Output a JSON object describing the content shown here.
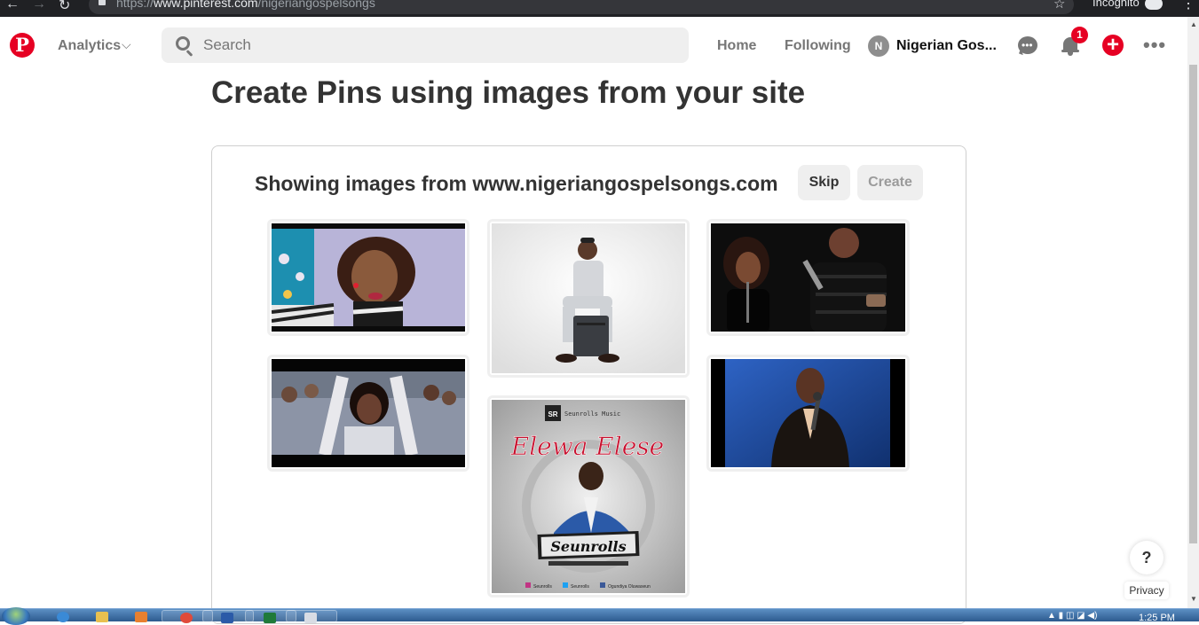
{
  "browser": {
    "url_scheme": "https://",
    "url_host": "www.pinterest.com",
    "url_path": "/nigeriangospelsongs",
    "incognito_label": "Incognito"
  },
  "header": {
    "analytics_label": "Analytics",
    "search_placeholder": "Search",
    "home_label": "Home",
    "following_label": "Following",
    "avatar_initial": "N",
    "profile_name": "Nigerian Gos...",
    "notification_count": "1",
    "icons": [
      "pinterest-logo-icon",
      "chevron-down-icon",
      "search-icon",
      "messages-icon",
      "bell-icon",
      "plus-icon",
      "more-icon"
    ],
    "colors": {
      "brand": "#e60023",
      "muted": "#767676"
    }
  },
  "main": {
    "title": "Create Pins using images from your site",
    "showing_text": "Showing images from www.nigeriangospelsongs.com",
    "skip_label": "Skip",
    "create_label": "Create",
    "images": [
      {
        "alt": "Woman singing in colorful headwrap"
      },
      {
        "alt": "Man in grey outfit seated on case"
      },
      {
        "alt": "Two singers performing on stage"
      },
      {
        "alt": "Woman singing with raised hands"
      },
      {
        "alt": "Elewa Elese album cover"
      },
      {
        "alt": "Man singing into microphone"
      }
    ],
    "album": {
      "label": "Seunrolls Music",
      "title": "Elewa Elese",
      "artist": "Seunrolls",
      "socials": [
        "Seunrolls",
        "Seunrolls",
        "Ogundiya Oluwaseun"
      ]
    }
  },
  "help": {
    "label": "?",
    "privacy": "Privacy"
  },
  "taskbar": {
    "time": "1:25 PM"
  }
}
